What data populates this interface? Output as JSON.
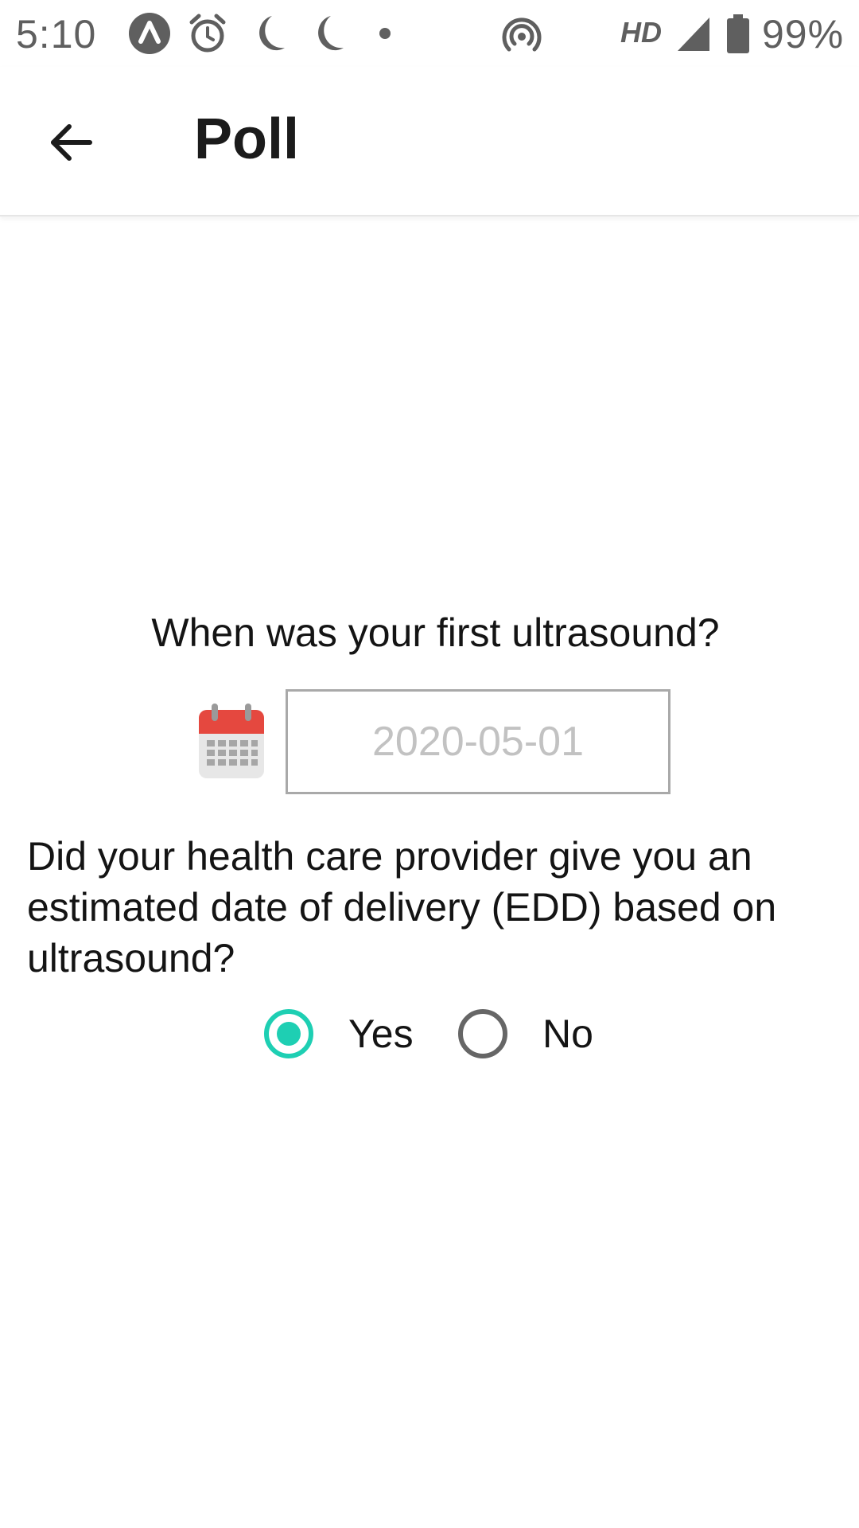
{
  "status_bar": {
    "time": "5:10",
    "network_label": "HD",
    "battery_percent": "99%",
    "icons": [
      "app-a-icon",
      "alarm-icon",
      "moon-icon",
      "moon-icon",
      "dot-icon",
      "hotspot-icon",
      "signal-icon",
      "battery-icon"
    ]
  },
  "app_bar": {
    "back_icon": "arrow-left-icon",
    "title": "Poll"
  },
  "poll": {
    "question_1": "When was your first ultrasound?",
    "calendar_icon": "calendar-icon",
    "date_placeholder": "2020-05-01",
    "question_2": "Did your health care provider give you an estimated date of delivery (EDD) based on ultrasound?",
    "options": [
      {
        "label": "Yes",
        "selected": true
      },
      {
        "label": "No",
        "selected": false
      }
    ]
  },
  "colors": {
    "accent": "#1ecfb3",
    "calendar_red": "#e5483f",
    "text": "#141414",
    "status_gray": "#5f5f5f"
  }
}
